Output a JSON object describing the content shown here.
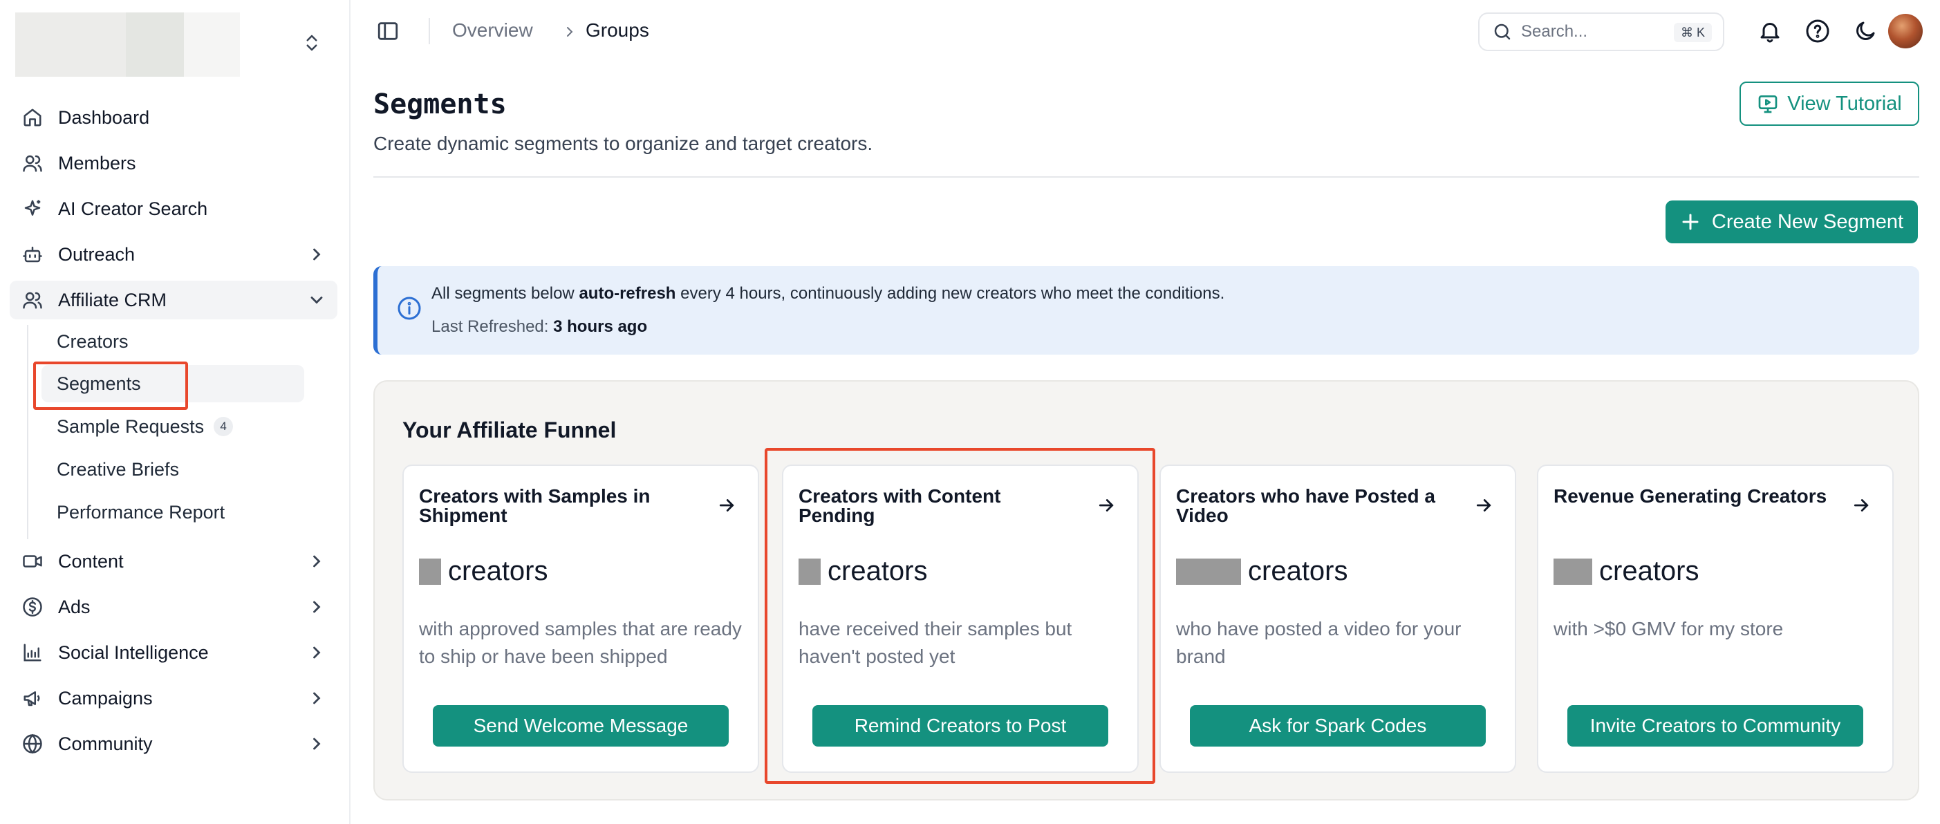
{
  "sidebar": {
    "nav": [
      {
        "label": "Dashboard",
        "icon": "home-icon"
      },
      {
        "label": "Members",
        "icon": "users-icon"
      },
      {
        "label": "AI Creator Search",
        "icon": "sparkles-icon"
      },
      {
        "label": "Outreach",
        "icon": "bot-icon"
      },
      {
        "label": "Affiliate CRM",
        "icon": "users-icon"
      },
      {
        "label": "Content",
        "icon": "video-icon"
      },
      {
        "label": "Ads",
        "icon": "dollar-icon"
      },
      {
        "label": "Social Intelligence",
        "icon": "chart-icon"
      },
      {
        "label": "Campaigns",
        "icon": "megaphone-icon"
      },
      {
        "label": "Community",
        "icon": "globe-icon"
      }
    ],
    "sub": [
      {
        "label": "Creators"
      },
      {
        "label": "Segments"
      },
      {
        "label": "Sample Requests",
        "badge": "4"
      },
      {
        "label": "Creative Briefs"
      },
      {
        "label": "Performance Report"
      }
    ]
  },
  "topbar": {
    "breadcrumb": [
      "Overview",
      "Groups"
    ],
    "search_placeholder": "Search...",
    "shortcut": "⌘ K"
  },
  "page": {
    "title": "Segments",
    "subtitle": "Create dynamic segments to organize and target creators.",
    "tutorial_label": "View Tutorial",
    "create_label": "Create New Segment"
  },
  "info": {
    "pre": "All segments below ",
    "bold": "auto-refresh",
    "post": " every 4 hours, continuously adding new creators who meet the conditions.",
    "refreshed_label": "Last Refreshed: ",
    "refreshed_value": "3 hours ago"
  },
  "funnel": {
    "title": "Your Affiliate Funnel",
    "cards": [
      {
        "title": "Creators with Samples in Shipment",
        "count_word": "creators",
        "desc": "with approved samples that are ready to ship or have been shipped",
        "button": "Send Welcome Message"
      },
      {
        "title": "Creators with Content Pending",
        "count_word": "creators",
        "desc": "have received their samples but haven't posted yet",
        "button": "Remind Creators to Post"
      },
      {
        "title": "Creators who have Posted a Video",
        "count_word": "creators",
        "desc": "who have posted a video for your brand",
        "button": "Ask for Spark Codes"
      },
      {
        "title": "Revenue Generating Creators",
        "count_word": "creators",
        "desc": "with >$0 GMV for my store",
        "button": "Invite Creators to Community"
      }
    ]
  },
  "colors": {
    "accent": "#14917f",
    "highlight": "#e8472c",
    "info_bg": "#e8f0fb",
    "info_border": "#2c6fd3"
  }
}
